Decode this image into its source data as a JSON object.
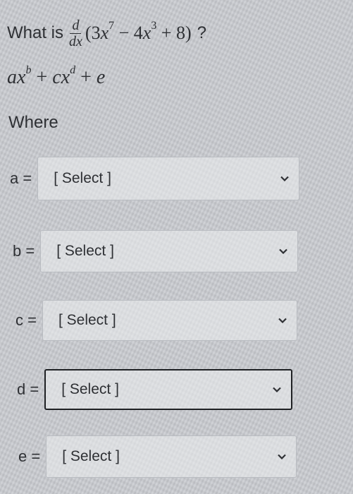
{
  "question": {
    "prefix": "What is",
    "frac_num": "d",
    "frac_den": "dx",
    "open": "(3",
    "x1": "x",
    "p1": "7",
    "minus": " − 4",
    "x2": "x",
    "p2": "3",
    "tail": " + 8)",
    "suffix": "?"
  },
  "expression": {
    "a": "a",
    "x1": "x",
    "b": "b",
    "plus1": " + ",
    "c": "c",
    "x2": "x",
    "d": "d",
    "plus2": " + ",
    "e": "e"
  },
  "where_label": "Where",
  "fields": [
    {
      "label": "a =",
      "value": "[ Select ]"
    },
    {
      "label": "b =",
      "value": "[ Select ]"
    },
    {
      "label": "c =",
      "value": "[ Select ]"
    },
    {
      "label": "d =",
      "value": "[ Select ]"
    },
    {
      "label": "e =",
      "value": "[ Select ]"
    }
  ]
}
